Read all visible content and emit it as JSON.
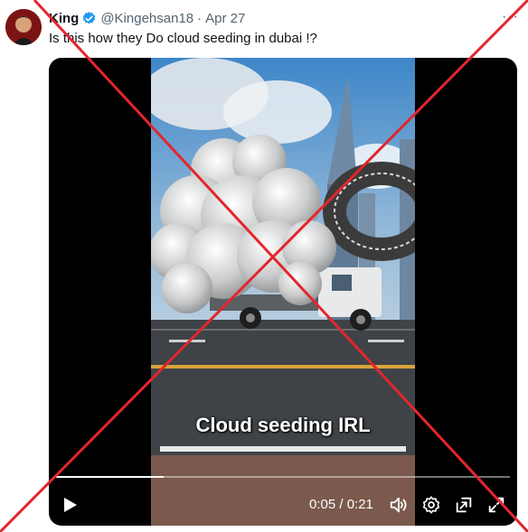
{
  "tweet": {
    "display_name": "King",
    "handle": "@Kingehsan18",
    "separator": "·",
    "date": "Apr 27",
    "text": "Is this how they Do cloud seeding in dubai !?",
    "more_label": "···",
    "verified": true
  },
  "video": {
    "caption": "Cloud seeding IRL",
    "current_time": "0:05",
    "duration": "0:21",
    "time_display": "0:05 / 0:21",
    "progress_fraction": 0.238
  },
  "icons": {
    "avatar": "avatar-image",
    "verified": "verified-badge-icon",
    "more": "more-options-icon",
    "play": "play-icon",
    "volume": "volume-icon",
    "settings": "settings-gear-icon",
    "pip": "picture-in-picture-icon",
    "fullscreen": "fullscreen-icon"
  },
  "colors": {
    "verified_blue": "#1d9bf0",
    "handle_gray": "#536471",
    "overlay_red": "#e3262c",
    "text": "#0f1419"
  }
}
